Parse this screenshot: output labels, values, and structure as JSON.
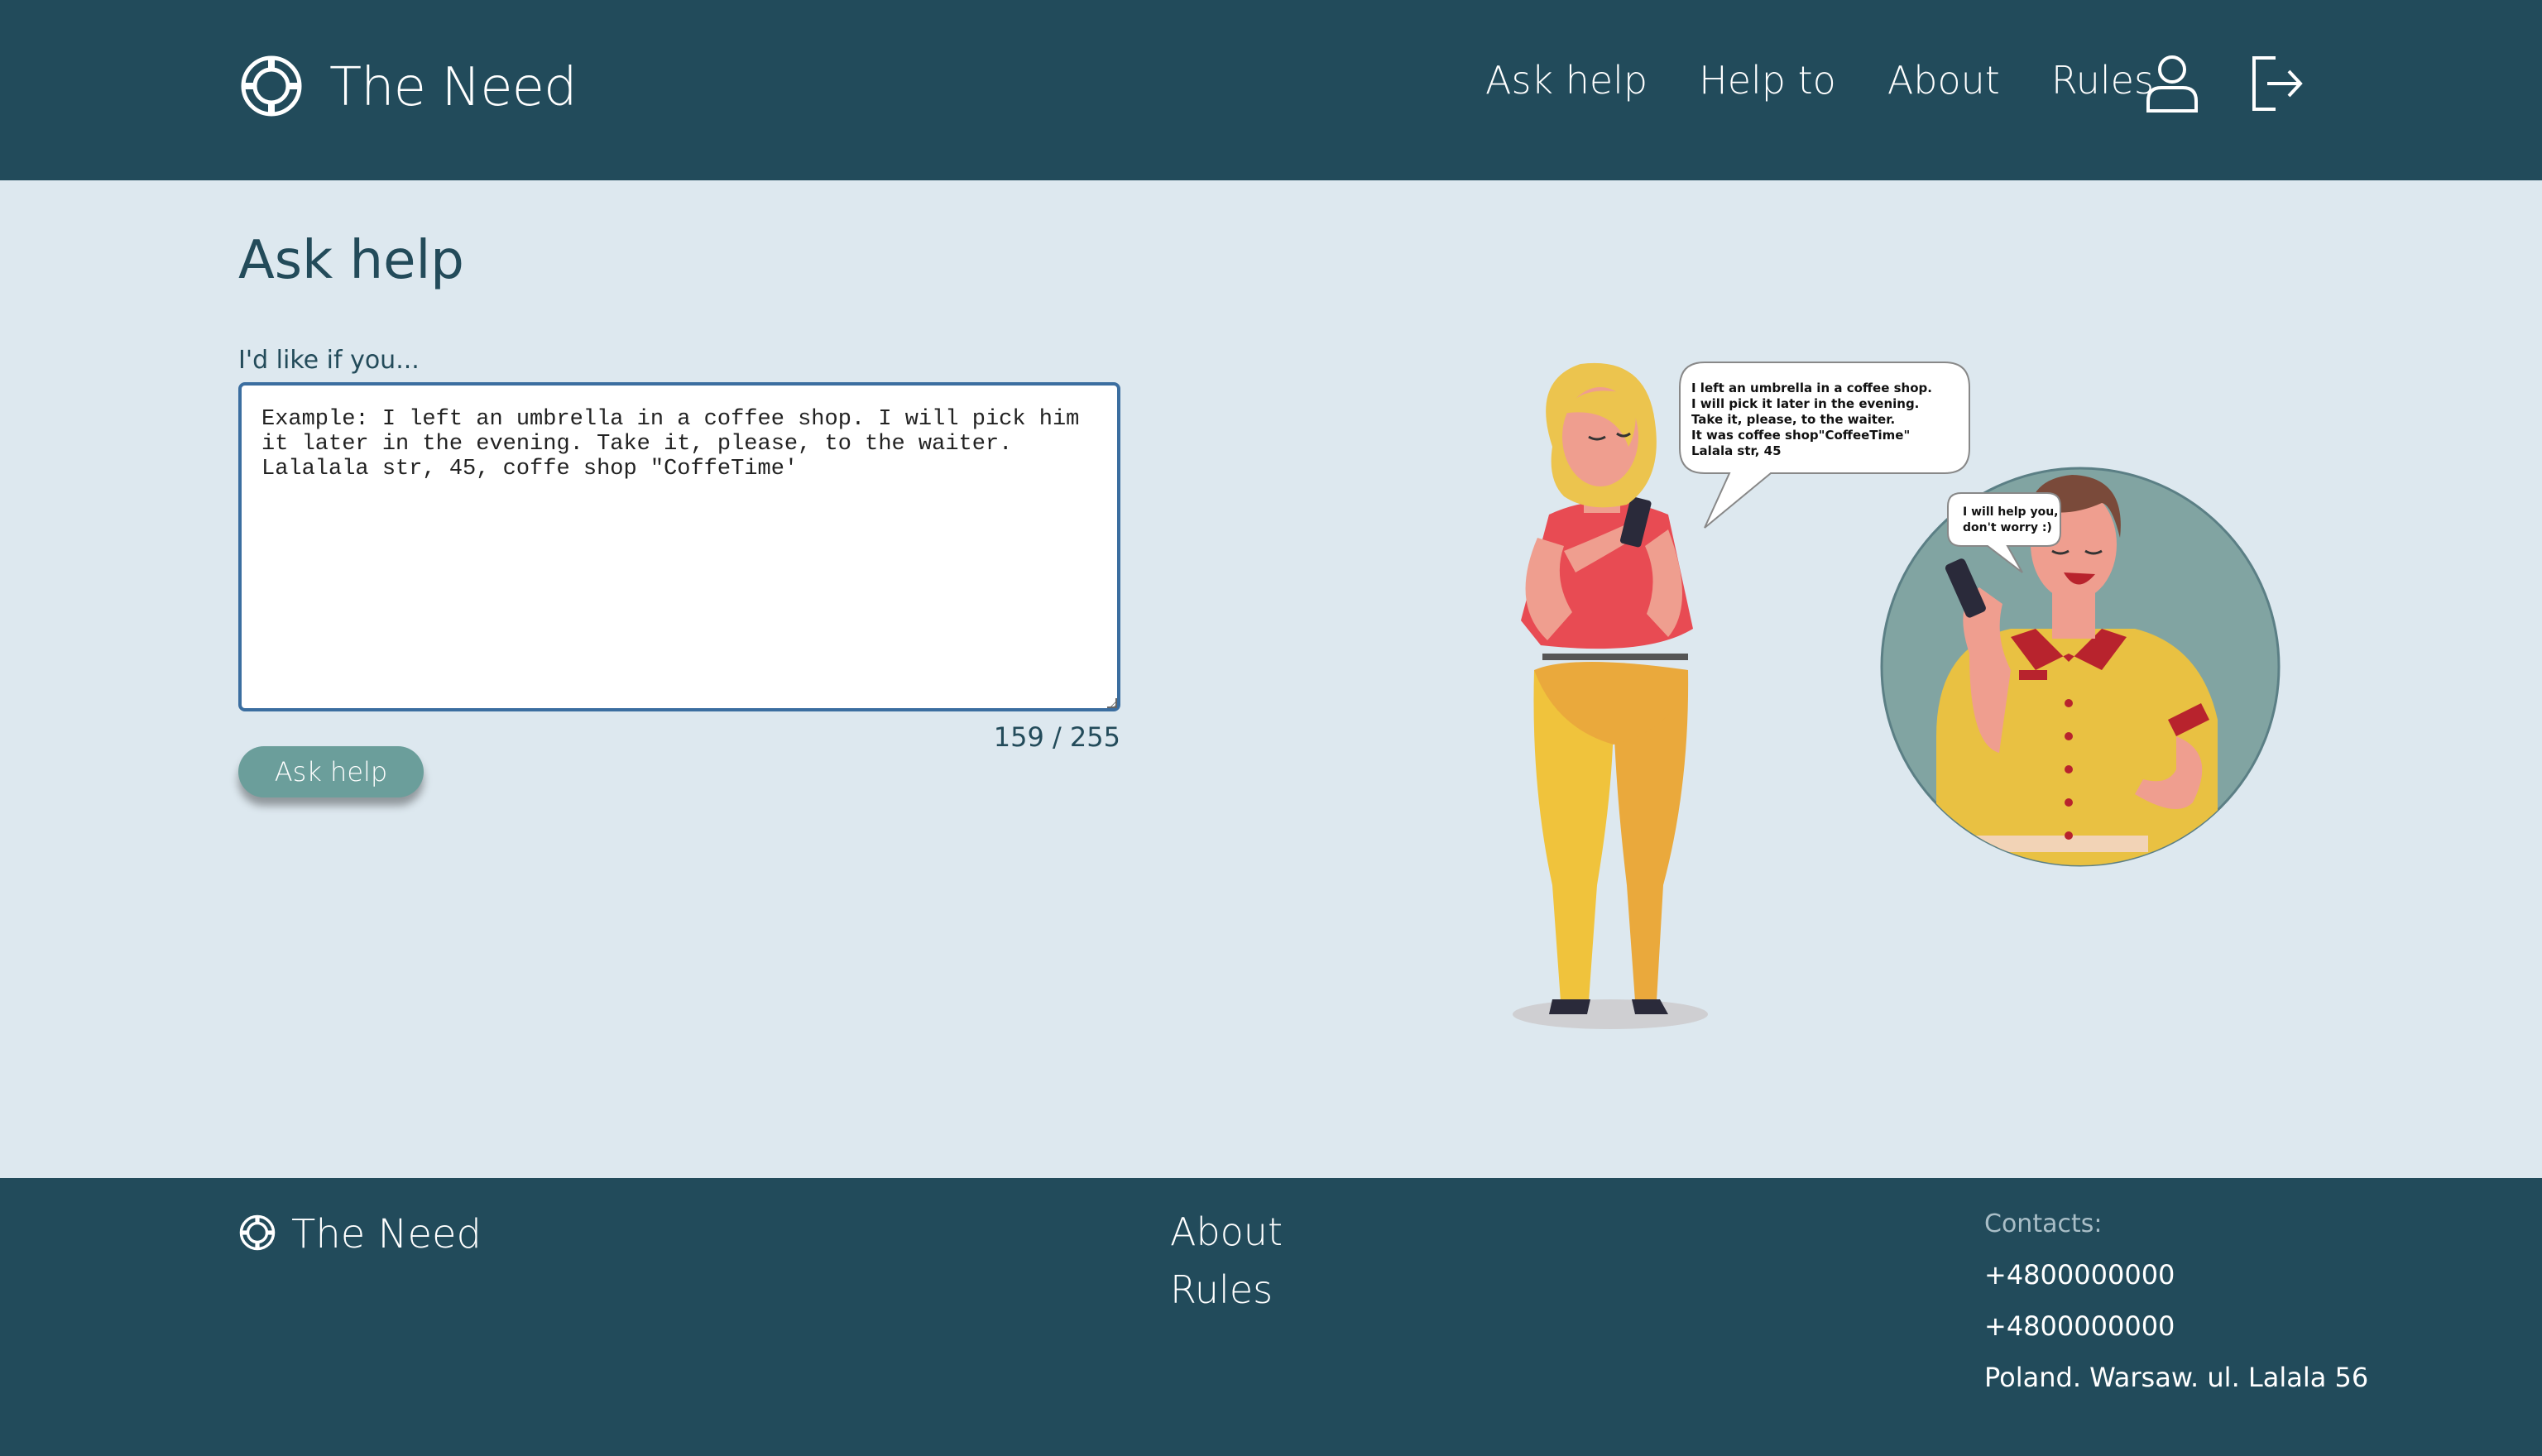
{
  "header": {
    "logo_text": "The Need",
    "nav": [
      "Ask help",
      "Help to",
      "About",
      "Rules"
    ]
  },
  "main": {
    "title": "Ask help",
    "field_label": "I'd like if you...",
    "textarea_value": "Example: I left an umbrella in a coffee shop. I will pick him\nit later in the evening. Take it, please, to the waiter.\nLalalala str, 45, coffe shop \"CoffeTime'",
    "counter": "159 / 255",
    "button_label": "Ask help"
  },
  "illustration": {
    "bubble_woman": [
      "I left an umbrella in a coffee shop.",
      "I will pick it later in the evening.",
      "Take it, please, to the waiter.",
      "It was coffee shop\"CoffeeTime\"",
      "Lalala str, 45"
    ],
    "bubble_man": [
      "I will help you,",
      "don't worry :)"
    ]
  },
  "footer": {
    "logo_text": "The Need",
    "links": [
      "About",
      "Rules"
    ],
    "contacts_label": "Contacts:",
    "phone_1": "+4800000000",
    "phone_2": "+4800000000",
    "address": "Poland. Warsaw. ul. Lalala 56"
  },
  "colors": {
    "header_bg": "#224b5b",
    "page_bg": "#dde8ef",
    "button_bg": "#6b9e9b",
    "textarea_border": "#3b6ea0"
  }
}
